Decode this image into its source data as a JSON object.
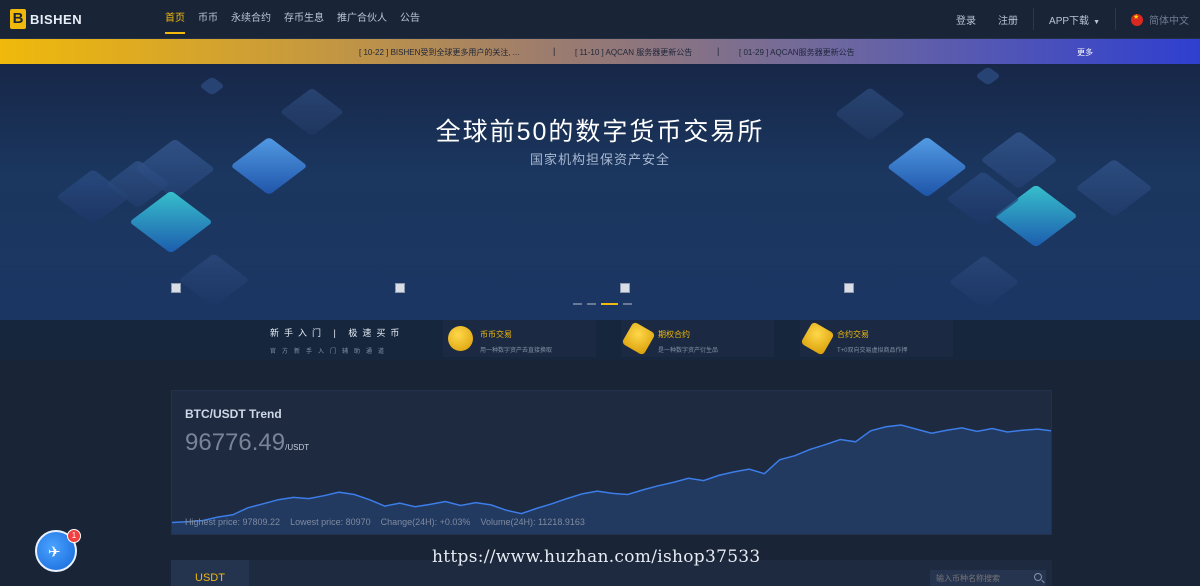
{
  "nav": {
    "logo_letter": "B",
    "logo_text": "BISHEN",
    "links": [
      "首页",
      "币币",
      "永续合约",
      "存币生息",
      "推广合伙人",
      "公告"
    ],
    "active_index": 0,
    "login": "登录",
    "register": "注册",
    "app_download": "APP下载",
    "language": "简体中文"
  },
  "notices": {
    "items": [
      "[ 10-22 ] BISHEN受到全球更多用户的关注, ...",
      "[ 11-10 ] AQCAN 服务器更新公告",
      "[ 01-29 ] AQCAN服务器更新公告"
    ],
    "separator": "|",
    "more": "更多"
  },
  "hero": {
    "title": "全球前50的数字货币交易所",
    "subtitle": "国家机构担保资产安全",
    "slide_count": 4,
    "active_slide": 2
  },
  "features": {
    "guide_title": "新手入门 | 极速买币",
    "guide_subtitle": "官方新手入门辅助通道",
    "cards": [
      {
        "name": "币币交易",
        "desc": "用一种数字资产去直接换取",
        "icon": "coin-icon"
      },
      {
        "name": "期权合约",
        "desc": "是一种数字资产衍生品",
        "icon": "hexagon-icon"
      },
      {
        "name": "合约交易",
        "desc": "T+0双向交易虚拟商品作押",
        "icon": "cube-icon"
      }
    ]
  },
  "chart": {
    "title": "BTC/USDT Trend",
    "price": "96776.49",
    "unit": "/USDT",
    "stats": {
      "high": "Highest price: 97809.22",
      "low": "Lowest price: 80970",
      "change": "Change(24H): +0.03%",
      "volume": "Volume(24H): 11218.9163"
    }
  },
  "chart_data": {
    "type": "area",
    "title": "BTC/USDT Trend",
    "series": [
      {
        "values": [
          80970,
          81100,
          81300,
          81900,
          82300,
          83500,
          84200,
          84900,
          85300,
          85100,
          85600,
          86200,
          85800,
          84900,
          83800,
          84300,
          83700,
          84100,
          84600,
          83900,
          84400,
          84000,
          83100,
          82500,
          83400,
          84200,
          85100,
          85900,
          86400,
          86000,
          85800,
          86600,
          87300,
          87900,
          88600,
          88200,
          89100,
          89700,
          90200,
          89400,
          91800,
          92500,
          93600,
          94400,
          95300,
          94900,
          96800,
          97500,
          97809,
          97100,
          96400,
          96900,
          97300,
          96700,
          97200,
          96600,
          96900,
          97100,
          96776
        ]
      }
    ],
    "colors": {
      "line": "#3c7de8",
      "fill": "#233c66"
    }
  },
  "market": {
    "tab": "USDT",
    "search_placeholder": "输入币种名称搜索"
  },
  "chat": {
    "badge": "1"
  },
  "watermark": "https://www.huzhan.com/ishop37533",
  "colors": {
    "accent": "#f0b90b",
    "background": "#1a2437"
  }
}
